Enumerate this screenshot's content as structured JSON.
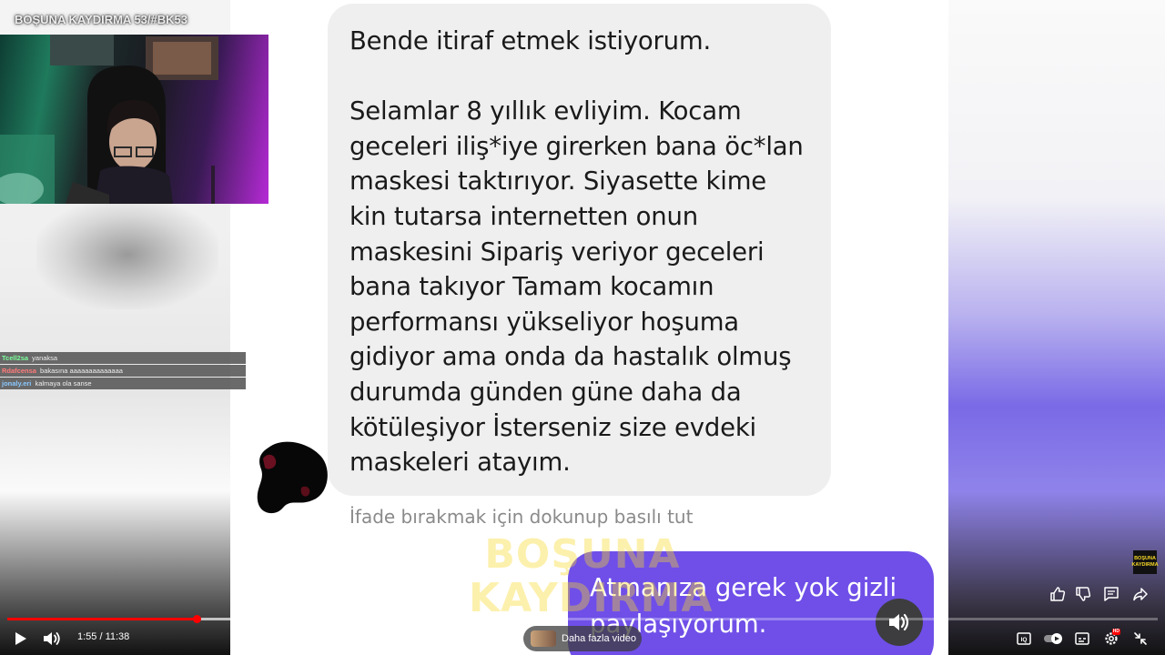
{
  "stream": {
    "title": "BOŞUNA KAYDIRMA 53/#BK53"
  },
  "twitch_chat": [
    {
      "user": "Tcell2sa",
      "message": "yanaksa"
    },
    {
      "user": "Rdafcensa",
      "message": "bakasına aaaaaaaaaaaaaa"
    },
    {
      "user": "jonaly.eri",
      "message": "kalmaya ola sanse"
    }
  ],
  "message": {
    "incoming": "Bende itiraf etmek istiyorum.\n\nSelamlar 8 yıllık evliyim. Kocam geceleri iliş*iye girerken bana öc*lan maskesi taktırıyor. Siyasette kime kin tutarsa internetten onun maskesini Sipariş veriyor geceleri bana takıyor Tamam kocamın performansı yükseliyor hoşuma gidiyor ama onda da hastalık olmuş durumda günden güne daha da kötüleşiyor İsterseniz size evdeki maskeleri atayım.",
    "reaction_hint": "İfade bırakmak için dokunup basılı tut",
    "outgoing": "Atmanıza gerek yok gizli paylaşıyorum.",
    "watermark": "BOŞUNA\nKAYDIRMA"
  },
  "player": {
    "current_time": "1:55",
    "duration": "11:38",
    "time_display": "1:55 / 11:38",
    "progress_fraction": 0.1648,
    "buffered_fraction": 0.215,
    "more_videos_label": "Daha fazla video",
    "channel_badge": "BOŞUNA\nKAYDIRMA",
    "quality_badge": "HD"
  },
  "icons": {
    "play": "play-icon",
    "volume": "volume-icon",
    "like": "thumbs-up-icon",
    "dislike": "thumbs-down-icon",
    "comments": "comment-icon",
    "share": "share-icon",
    "autoplay": "autoplay-toggle-icon",
    "subtitles": "subtitles-icon",
    "settings": "gear-icon",
    "exit_fullscreen": "exit-fullscreen-icon",
    "sound": "speaker-icon"
  },
  "colors": {
    "outgoing_bubble": "#6f4fe8",
    "incoming_bubble": "#efefef",
    "progress": "#ff0000",
    "watermark": "#f6d828"
  }
}
